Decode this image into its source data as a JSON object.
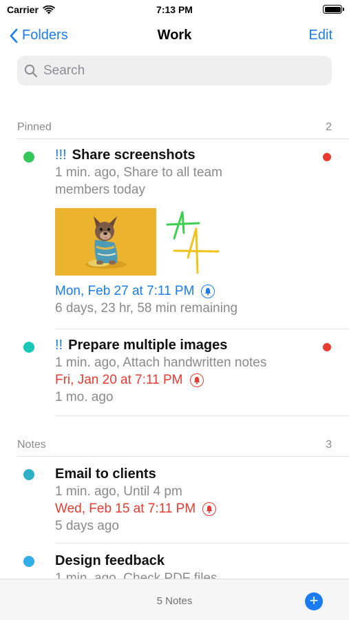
{
  "status": {
    "carrier": "Carrier",
    "time": "7:13 PM"
  },
  "nav": {
    "back_label": "Folders",
    "title": "Work",
    "edit_label": "Edit"
  },
  "search": {
    "placeholder": "Search"
  },
  "sections": [
    {
      "title": "Pinned",
      "count": "2"
    },
    {
      "title": "Notes",
      "count": "3"
    }
  ],
  "notes": [
    {
      "priority": "!!!",
      "title": "Share screenshots",
      "summary_line1": "1 min. ago, Share to all team",
      "summary_line2": "members today",
      "reminder": "Mon, Feb 27 at 7:11 PM",
      "remaining": "6 days, 23 hr, 58 min remaining",
      "dot_color": "#34c759",
      "reminder_color": "#1a7cf0"
    },
    {
      "priority": "!!",
      "title": "Prepare multiple images",
      "summary": "1 min. ago, Attach handwritten notes",
      "reminder": "Fri, Jan 20 at 7:11 PM",
      "remaining": "1 mo. ago",
      "dot_color": "#19c7b7",
      "reminder_color": "#e83a30"
    },
    {
      "title": "Email to clients",
      "summary": "1 min. ago, Until 4 pm",
      "reminder": "Wed, Feb 15 at 7:11 PM",
      "remaining": "5 days ago",
      "dot_color": "#30b0c7",
      "reminder_color": "#e83a30"
    },
    {
      "title": "Design feedback",
      "summary": "1 min. ago, Check PDF files",
      "dot_color": "#32ade6"
    }
  ],
  "icons": {
    "back": "chevron-left-icon",
    "search": "magnifying-glass-icon",
    "bell": "bell-icon",
    "compose": "plus-circle-icon"
  },
  "toolbar": {
    "count_label": "5 Notes"
  }
}
